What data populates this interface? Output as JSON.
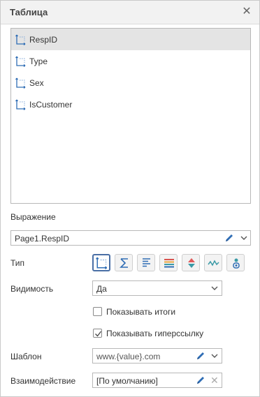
{
  "header": {
    "title": "Таблица",
    "close_icon": "close-icon"
  },
  "fields": [
    {
      "label": "RespID",
      "selected": true
    },
    {
      "label": "Type",
      "selected": false
    },
    {
      "label": "Sex",
      "selected": false
    },
    {
      "label": "IsCustomer",
      "selected": false
    }
  ],
  "expression": {
    "label": "Выражение",
    "value": "Page1.RespID"
  },
  "type": {
    "label": "Тип",
    "buttons": [
      "field-type",
      "sum",
      "align-left",
      "table-rows",
      "sort",
      "sparkline",
      "indicator"
    ],
    "active": "field-type"
  },
  "visibility": {
    "label": "Видимость",
    "value": "Да"
  },
  "options": {
    "show_totals": {
      "label": "Показывать итоги",
      "checked": false
    },
    "show_hyperlink": {
      "label": "Показывать гиперссылку",
      "checked": true
    }
  },
  "template": {
    "label": "Шаблон",
    "placeholder": "www.{value}.com"
  },
  "interaction": {
    "label": "Взаимодействие",
    "value": "[По умолчанию]"
  },
  "colors": {
    "accent": "#2f6db5",
    "icon_teal": "#3a9aa6",
    "selected_row": "#e4e4e4"
  }
}
